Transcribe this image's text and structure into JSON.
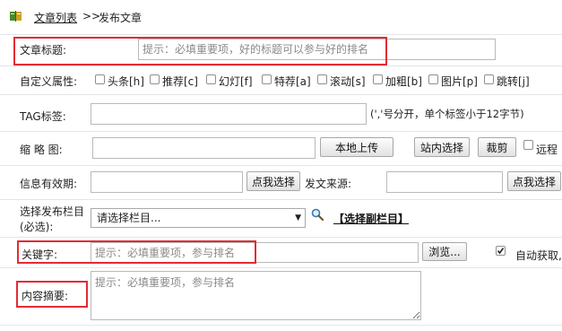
{
  "breadcrumb": {
    "link": "文章列表",
    "separator": ">>",
    "current": "发布文章"
  },
  "form": {
    "title": {
      "label": "文章标题:",
      "placeholder": "提示：必填重要项，好的标题可以参与好的排名"
    },
    "attributes": {
      "label": "自定义属性:",
      "items": [
        "头条[h]",
        "推荐[c]",
        "幻灯[f]",
        "特荐[a]",
        "滚动[s]",
        "加粗[b]",
        "图片[p]",
        "跳转[j]"
      ]
    },
    "tag": {
      "label": "TAG标签:",
      "hint": "(','号分开，单个标签小于12字节)"
    },
    "thumbnail": {
      "label": "缩 略 图:",
      "upload_button": "本地上传",
      "site_button": "站内选择",
      "crop_button": "裁剪",
      "remote_label": "远程"
    },
    "validity": {
      "label": "信息有效期:",
      "button": "点我选择"
    },
    "source": {
      "label": "发文来源:",
      "button": "点我选择"
    },
    "column": {
      "label_line1": "选择发布栏目",
      "label_line2": "(必选):",
      "selected": "请选择栏目...",
      "sub_link": "【选择副栏目】"
    },
    "keywords": {
      "label": "关键字:",
      "placeholder": "提示：必填重要项，参与排名",
      "browse_button": "浏览...",
      "auto_label": "自动获取,"
    },
    "summary": {
      "label": "内容摘要:",
      "placeholder": "提示：必填重要项，参与排名"
    }
  },
  "colors": {
    "highlight": "#e32b33",
    "row_border": "#e3e6ea",
    "link": "#1a1a1a"
  },
  "icons": {
    "breadcrumb": "book-icon",
    "column_search": "magnifier-icon"
  }
}
